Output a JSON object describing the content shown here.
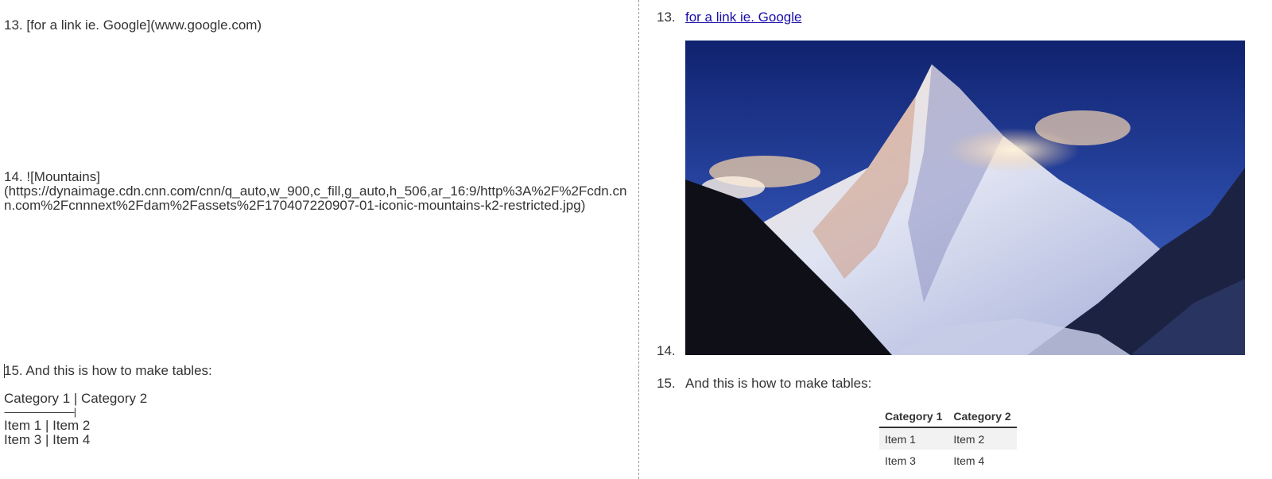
{
  "editor": {
    "line13": "13. [for a link ie. Google](www.google.com)",
    "line14a": "14. ![Mountains]",
    "line14b": "(https://dynaimage.cdn.cnn.com/cnn/q_auto,w_900,c_fill,g_auto,h_506,ar_16:9/http%3A%2F%2Fcdn.cnn.com%2Fcnnnext%2Fdam%2Fassets%2F170407220907-01-iconic-mountains-k2-restricted.jpg)",
    "line15": "15. And this is how to make tables:",
    "table_header": "Category 1 | Category 2",
    "table_sep": "-------------------------------|",
    "table_row1": "Item 1 | Item 2",
    "table_row2": "Item 3 | Item 4"
  },
  "preview": {
    "n13": "13.",
    "link_text": "for a link ie. Google",
    "n14": "14.",
    "image_alt": "Mountains",
    "n15": "15.",
    "p15": "And this is how to make tables:",
    "table": {
      "headers": [
        "Category 1",
        "Category 2"
      ],
      "rows": [
        [
          "Item 1",
          "Item 2"
        ],
        [
          "Item 3",
          "Item 4"
        ]
      ]
    }
  },
  "colors": {
    "link": "#1a0dab",
    "text": "#333333",
    "divider": "#999999"
  }
}
